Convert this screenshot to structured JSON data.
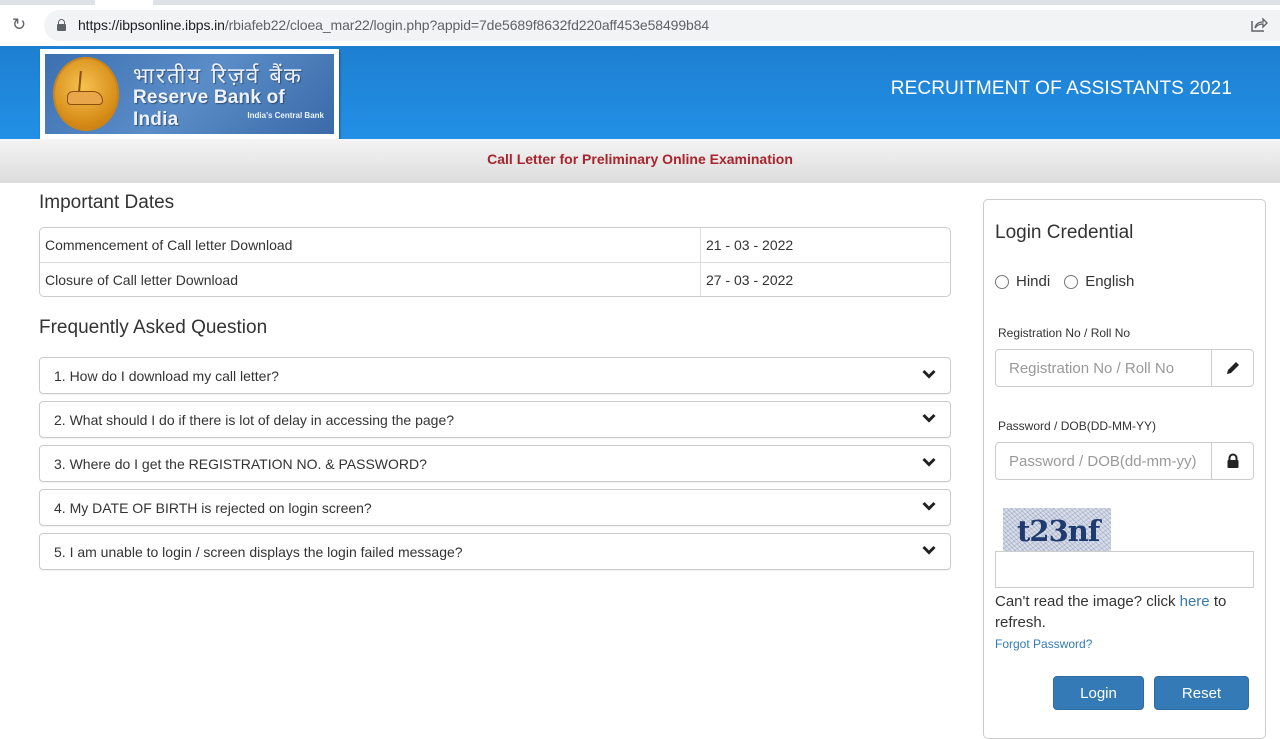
{
  "browser": {
    "url_host": "https://ibpsonline.ibps.in",
    "url_path": "/rbiafeb22/cloea_mar22/login.php?appid=7de5689f8632fd220aff453e58499b84",
    "icons": {
      "reload": "reload-icon",
      "lock": "lock-icon",
      "share": "share-icon"
    }
  },
  "header": {
    "logo_hindi": "भारतीय रिज़र्व बैंक",
    "logo_english": "Reserve Bank of India",
    "logo_tagline": "India's Central Bank",
    "title": "RECRUITMENT OF ASSISTANTS 2021",
    "colors": {
      "header_blue": "#2290e6",
      "subheader_red": "#a9242c"
    }
  },
  "subheader": {
    "title": "Call Letter for Preliminary Online Examination"
  },
  "important_dates": {
    "title": "Important Dates",
    "rows": [
      {
        "label": "Commencement of Call letter Download",
        "date": "21 - 03 - 2022"
      },
      {
        "label": "Closure of Call letter Download",
        "date": "27 - 03 - 2022"
      }
    ]
  },
  "faq": {
    "title": "Frequently Asked Question",
    "items": [
      "1. How do I download my call letter?",
      "2. What should I do if there is lot of delay in accessing the page?",
      "3. Where do I get the REGISTRATION NO. & PASSWORD?",
      "4. My DATE OF BIRTH is rejected on login screen?",
      "5. I am unable to login / screen displays the login failed message?"
    ]
  },
  "login": {
    "title": "Login Credential",
    "languages": [
      "Hindi",
      "English"
    ],
    "registration_label": "Registration No / Roll No",
    "registration_placeholder": "Registration No / Roll No",
    "password_label": "Password / DOB(DD-MM-YY)",
    "password_placeholder": "Password / DOB(dd-mm-yy)",
    "captcha_text": "t23nf",
    "captcha_value": "",
    "refresh_prefix": "Can't read the image? click ",
    "refresh_link": "here",
    "refresh_suffix": " to refresh.",
    "forgot_password": "Forgot Password?",
    "login_button": "Login",
    "reset_button": "Reset",
    "button_color": "#337ab7"
  }
}
